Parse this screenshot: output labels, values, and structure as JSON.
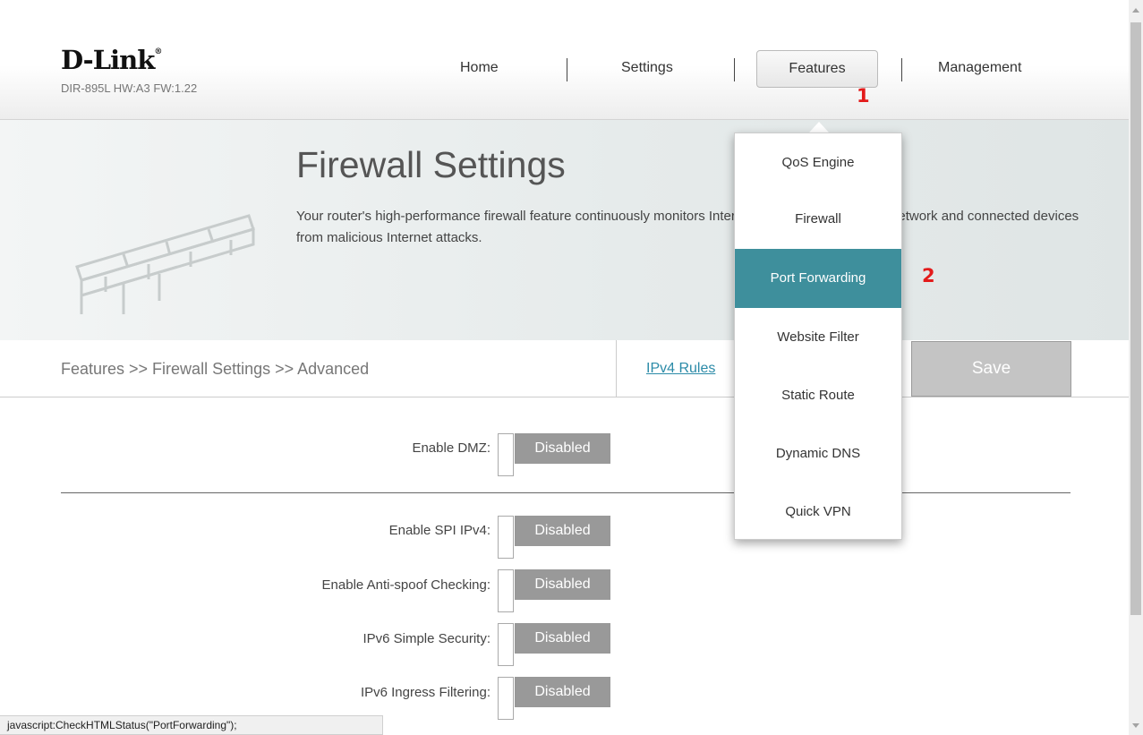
{
  "header": {
    "logo": "D-Link",
    "logo_mark": "®",
    "model": "DIR-895L HW:A3 FW:1.22",
    "nav": {
      "home": "Home",
      "settings": "Settings",
      "features": "Features",
      "management": "Management"
    }
  },
  "markers": {
    "one": "1",
    "two": "2"
  },
  "banner": {
    "title": "Firewall Settings",
    "description": "Your router's high-performance firewall feature continuously monitors Internet traffic, protecting your network and connected devices from malicious Internet attacks."
  },
  "breadcrumb": "Features >> Firewall Settings >> Advanced",
  "ipv4_rules": "IPv4 Rules",
  "save_label": "Save",
  "fields": [
    {
      "label": "Enable DMZ:",
      "state": "Disabled"
    },
    {
      "label": "Enable SPI IPv4:",
      "state": "Disabled"
    },
    {
      "label": "Enable Anti-spoof Checking:",
      "state": "Disabled"
    },
    {
      "label": "IPv6 Simple Security:",
      "state": "Disabled"
    },
    {
      "label": "IPv6 Ingress Filtering:",
      "state": "Disabled"
    }
  ],
  "dropdown": {
    "items": [
      "QoS Engine",
      "Firewall",
      "Port Forwarding",
      "Website Filter",
      "Static Route",
      "Dynamic DNS",
      "Quick VPN"
    ],
    "active": "Port Forwarding"
  },
  "status_text": "javascript:CheckHTMLStatus(\"PortForwarding\");",
  "colors": {
    "accent": "#3e8f9c",
    "marker": "#e31b1b",
    "link": "#2c8ba8",
    "toggle": "#999999"
  }
}
